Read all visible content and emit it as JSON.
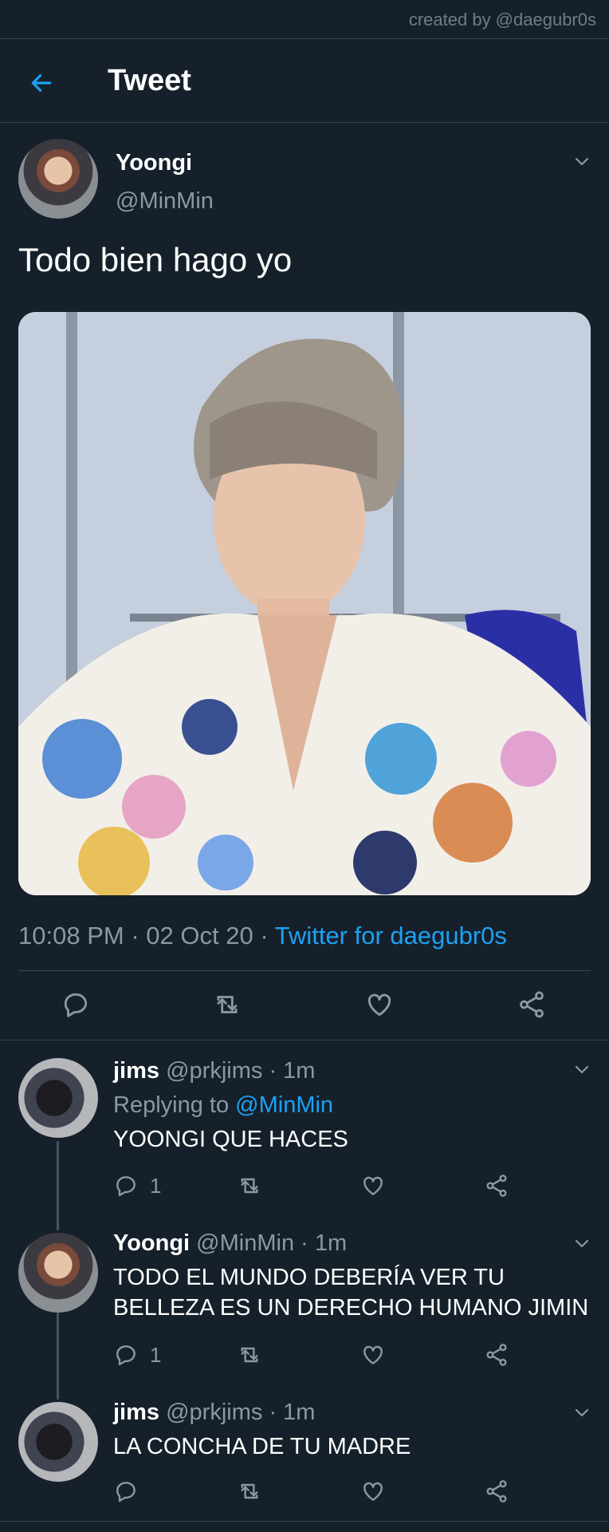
{
  "credit": "created by @daegubr0s",
  "header": {
    "title": "Tweet"
  },
  "tweet": {
    "author_name": "Yoongi",
    "author_handle": "@MinMin",
    "text": "Todo bien hago yo",
    "time": "10:08 PM",
    "date": "02 Oct 20",
    "source": "Twitter for daegubr0s",
    "media_icon": "photo"
  },
  "replies": [
    {
      "name": "jims",
      "handle": "@prkjims",
      "age": "1m",
      "replying_prefix": "Replying to",
      "replying_to": "@MinMin",
      "text": "YOONGI QUE HACES",
      "reply_count": "1"
    },
    {
      "name": "Yoongi",
      "handle": "@MinMin",
      "age": "1m",
      "text_line1": "TODO EL MUNDO DEBERÍA VER TU",
      "text_line2": "BELLEZA ES UN DERECHO HUMANO JIMIN",
      "reply_count": "1"
    },
    {
      "name": "jims",
      "handle": "@prkjims",
      "age": "1m",
      "text": "LA CONCHA DE TU MADRE"
    }
  ],
  "separator": "·",
  "colors": {
    "background": "#15202b",
    "accent": "#1da1f2",
    "muted": "#8899a6",
    "divider": "#38444d"
  }
}
